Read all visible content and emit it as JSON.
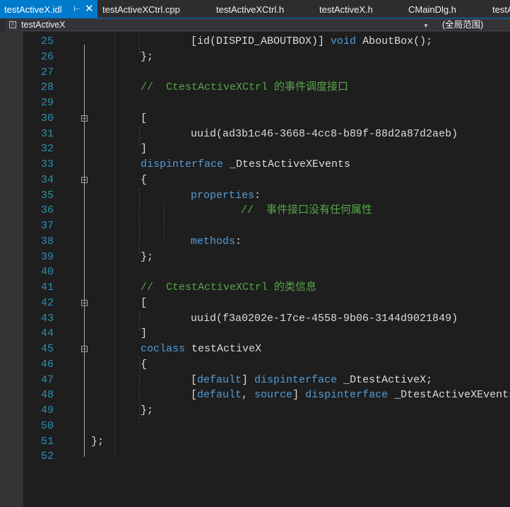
{
  "tabs": [
    {
      "label": "testActiveX.idl",
      "active": true,
      "pin_icon": "pin",
      "close_icon": "close"
    },
    {
      "label": "testActiveXCtrl.cpp"
    },
    {
      "label": "testActiveXCtrl.h"
    },
    {
      "label": "testActiveX.h"
    },
    {
      "label": "CMainDlg.h"
    },
    {
      "label": "testA"
    }
  ],
  "navbar": {
    "scope_icon": "class-icon",
    "scope": "testActiveX",
    "member": "(全局范围)"
  },
  "editor": {
    "lines": [
      {
        "n": "25",
        "segs": [
          {
            "t": "    [id(DISPID_ABOUTBOX)] ",
            "c": "txt"
          },
          {
            "t": "void",
            "c": "kw"
          },
          {
            "t": " AboutBox();",
            "c": "txt"
          }
        ]
      },
      {
        "n": "26",
        "segs": [
          {
            "t": "};",
            "c": "txt"
          }
        ]
      },
      {
        "n": "27",
        "segs": []
      },
      {
        "n": "28",
        "segs": [
          {
            "t": "//  CtestActiveXCtrl 的事件调度接口",
            "c": "cm"
          }
        ]
      },
      {
        "n": "29",
        "segs": []
      },
      {
        "n": "30",
        "segs": [
          {
            "t": "[",
            "c": "txt"
          }
        ]
      },
      {
        "n": "31",
        "segs": [
          {
            "t": "    uuid(ad3b1c46-3668-4cc8-b89f-88d2a87d2aeb)",
            "c": "txt"
          }
        ]
      },
      {
        "n": "32",
        "segs": [
          {
            "t": "]",
            "c": "txt"
          }
        ]
      },
      {
        "n": "33",
        "segs": [
          {
            "t": "dispinterface",
            "c": "kw"
          },
          {
            "t": " _DtestActiveXEvents",
            "c": "txt"
          }
        ]
      },
      {
        "n": "34",
        "segs": [
          {
            "t": "{",
            "c": "txt"
          }
        ]
      },
      {
        "n": "35",
        "segs": [
          {
            "t": "    ",
            "c": "txt"
          },
          {
            "t": "properties",
            "c": "kw"
          },
          {
            "t": ":",
            "c": "txt"
          }
        ]
      },
      {
        "n": "36",
        "segs": [
          {
            "t": "        //  事件接口没有任何属性",
            "c": "cm"
          }
        ]
      },
      {
        "n": "37",
        "segs": []
      },
      {
        "n": "38",
        "segs": [
          {
            "t": "    ",
            "c": "txt"
          },
          {
            "t": "methods",
            "c": "kw"
          },
          {
            "t": ":",
            "c": "txt"
          }
        ]
      },
      {
        "n": "39",
        "segs": [
          {
            "t": "};",
            "c": "txt"
          }
        ]
      },
      {
        "n": "40",
        "segs": []
      },
      {
        "n": "41",
        "segs": [
          {
            "t": "//  CtestActiveXCtrl 的类信息",
            "c": "cm"
          }
        ]
      },
      {
        "n": "42",
        "segs": [
          {
            "t": "[",
            "c": "txt"
          }
        ]
      },
      {
        "n": "43",
        "segs": [
          {
            "t": "    uuid(f3a0202e-17ce-4558-9b06-3144d9021849)",
            "c": "txt"
          }
        ]
      },
      {
        "n": "44",
        "segs": [
          {
            "t": "]",
            "c": "txt"
          }
        ]
      },
      {
        "n": "45",
        "segs": [
          {
            "t": "coclass",
            "c": "kw"
          },
          {
            "t": " testActiveX",
            "c": "txt"
          }
        ]
      },
      {
        "n": "46",
        "segs": [
          {
            "t": "{",
            "c": "txt"
          }
        ]
      },
      {
        "n": "47",
        "segs": [
          {
            "t": "    [",
            "c": "txt"
          },
          {
            "t": "default",
            "c": "kw"
          },
          {
            "t": "] ",
            "c": "txt"
          },
          {
            "t": "dispinterface",
            "c": "kw"
          },
          {
            "t": " _DtestActiveX;",
            "c": "txt"
          }
        ]
      },
      {
        "n": "48",
        "segs": [
          {
            "t": "    [",
            "c": "txt"
          },
          {
            "t": "default",
            "c": "kw"
          },
          {
            "t": ", ",
            "c": "txt"
          },
          {
            "t": "source",
            "c": "kw"
          },
          {
            "t": "] ",
            "c": "txt"
          },
          {
            "t": "dispinterface",
            "c": "kw"
          },
          {
            "t": " _DtestActiveXEvents;",
            "c": "txt"
          }
        ]
      },
      {
        "n": "49",
        "segs": [
          {
            "t": "};",
            "c": "txt"
          }
        ]
      },
      {
        "n": "50",
        "segs": []
      },
      {
        "n": "51",
        "segs": [
          {
            "t": "};",
            "c": "txt"
          }
        ]
      },
      {
        "n": "52",
        "segs": []
      }
    ]
  },
  "colors": {
    "editor_bg": "#1e1e1e",
    "accent": "#007acc",
    "keyword": "#569cd6",
    "comment": "#57a64a",
    "line_number": "#2b91af",
    "text": "#dcdcdc"
  }
}
